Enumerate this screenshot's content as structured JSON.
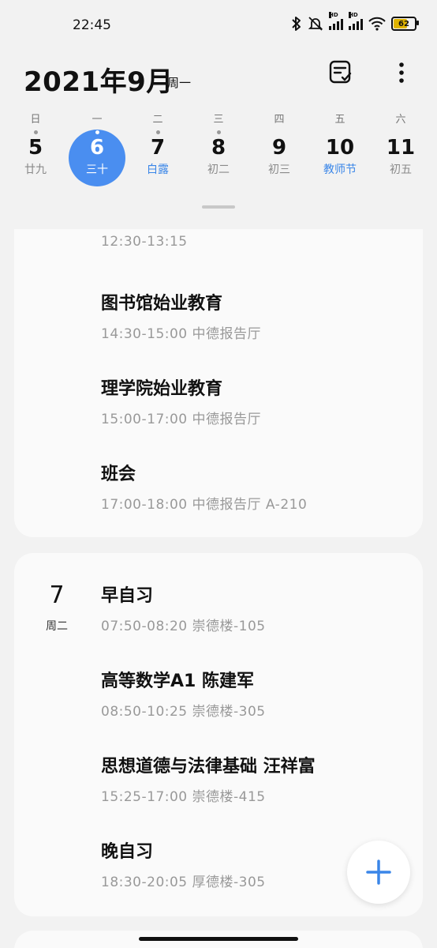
{
  "status_bar": {
    "time": "22:45",
    "battery_level": "62",
    "icons": [
      "bluetooth-icon",
      "bell-off-icon",
      "signal-hd-icon",
      "signal-hd-icon",
      "wifi-icon",
      "battery-icon"
    ],
    "hd_label": "HD"
  },
  "header": {
    "title": "2021年9月",
    "weekday": "周一"
  },
  "week": {
    "days": [
      {
        "weekday": "日",
        "date": "5",
        "lunar": "廿九",
        "dot": true,
        "highlight": false
      },
      {
        "weekday": "一",
        "date": "6",
        "lunar": "三十",
        "dot": true,
        "selected": true
      },
      {
        "weekday": "二",
        "date": "7",
        "lunar": "白露",
        "dot": true,
        "highlight": true
      },
      {
        "weekday": "三",
        "date": "8",
        "lunar": "初二",
        "dot": true,
        "highlight": false
      },
      {
        "weekday": "四",
        "date": "9",
        "lunar": "初三",
        "dot": false,
        "highlight": false
      },
      {
        "weekday": "五",
        "date": "10",
        "lunar": "教师节",
        "dot": false,
        "highlight": true
      },
      {
        "weekday": "六",
        "date": "11",
        "lunar": "初五",
        "dot": false,
        "highlight": false
      }
    ]
  },
  "card1": {
    "events": [
      {
        "title": "",
        "meta": "12:30-13:15"
      },
      {
        "title": "图书馆始业教育",
        "meta": "14:30-15:00  中德报告厅"
      },
      {
        "title": "理学院始业教育",
        "meta": "15:00-17:00  中德报告厅"
      },
      {
        "title": "班会",
        "meta": "17:00-18:00  中德报告厅 A-210"
      }
    ]
  },
  "card2": {
    "date": "7",
    "weekday": "周二",
    "events": [
      {
        "title": "早自习",
        "meta": "07:50-08:20  崇德楼-105"
      },
      {
        "title": "高等数学A1 陈建军",
        "meta": "08:50-10:25  崇德楼-305"
      },
      {
        "title": "思想道德与法律基础 汪祥富",
        "meta": "15:25-17:00  崇德楼-415"
      },
      {
        "title": "晚自习",
        "meta": "18:30-20:05  厚德楼-305"
      }
    ]
  },
  "colors": {
    "accent": "#4a8ef0",
    "holiday_text": "#3a86e8",
    "background": "#f2f2f2",
    "card": "#fafafa",
    "secondary_text": "#999999"
  }
}
